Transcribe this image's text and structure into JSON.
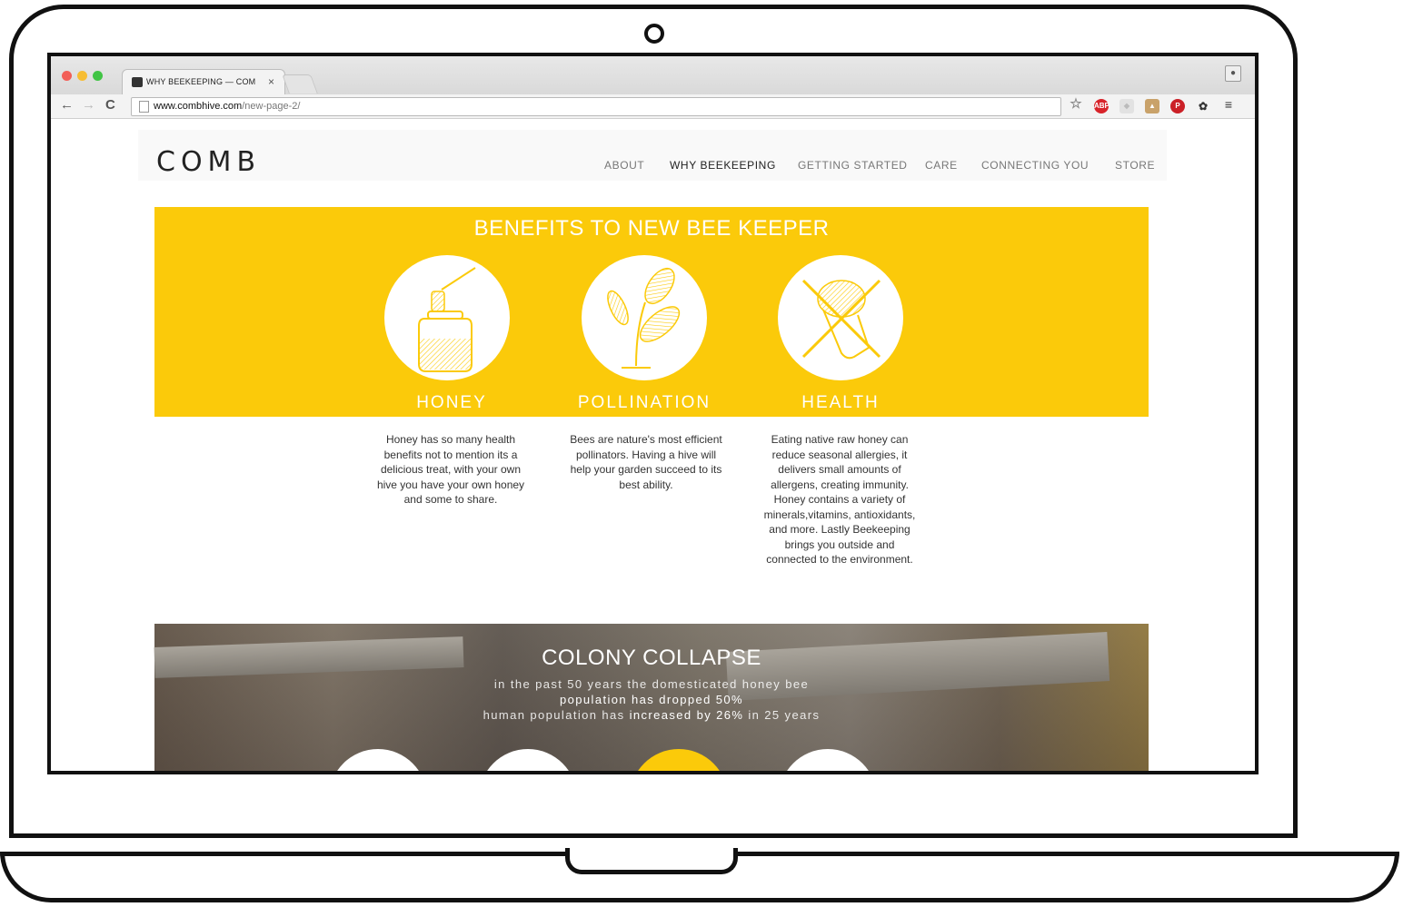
{
  "browser": {
    "tab_title": "WHY BEEKEEPING — COM",
    "tab_close": "×",
    "url_host": "www.combhive.com",
    "url_path": "/new-page-2/",
    "extensions": [
      "star-icon",
      "adblock-plus-icon",
      "shield-icon",
      "fox-extension-icon",
      "pinterest-icon",
      "bug-icon",
      "menu-icon"
    ],
    "abp_label": "ABP"
  },
  "site": {
    "logo": "COMB",
    "nav": [
      "ABOUT",
      "WHY BEEKEEPING",
      "GETTING STARTED",
      "CARE",
      "CONNECTING YOU",
      "STORE"
    ],
    "active_nav": "WHY BEEKEEPING"
  },
  "benefits": {
    "title": "BENEFITS TO NEW BEE KEEPER",
    "accent_color": "#fbca0a",
    "items": [
      {
        "label": "HONEY",
        "icon": "honey-jar-icon",
        "text": "Honey has so many health benefits not to mention its a delicious treat, with your own hive you have your own honey and some to share."
      },
      {
        "label": "POLLINATION",
        "icon": "plant-icon",
        "text": "Bees are nature's most efficient pollinators. Having a hive will help your garden succeed to its best ability."
      },
      {
        "label": "HEALTH",
        "icon": "allergy-crossed-icon",
        "text": "Eating native raw honey can reduce seasonal allergies, it delivers small amounts of allergens, creating immunity. Honey contains a variety of minerals,vitamins, antioxidants, and more. Lastly Beekeeping brings you outside and connected to the environment."
      }
    ]
  },
  "colony": {
    "title": "COLONY COLLAPSE",
    "line1": "in the past 50 years the domesticated honey bee",
    "line2": "population has dropped 50%",
    "line3_pre": "human population has ",
    "line3_bold": "increased by 26%",
    "line3_post": " in 25 years"
  }
}
